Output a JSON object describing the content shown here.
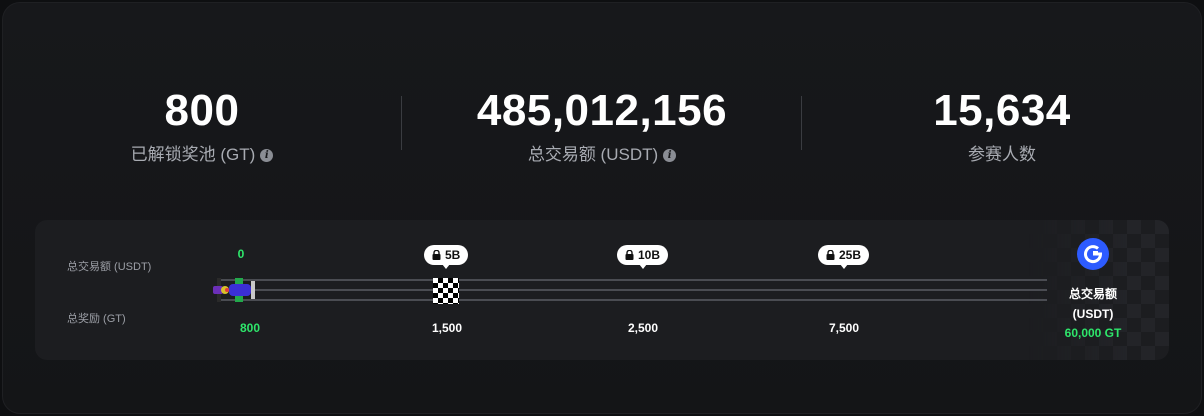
{
  "stats": [
    {
      "value": "800",
      "label": "已解锁奖池 (GT)",
      "info": true
    },
    {
      "value": "485,012,156",
      "label": "总交易额 (USDT)",
      "info": true
    },
    {
      "value": "15,634",
      "label": "参赛人数",
      "info": false
    }
  ],
  "progress": {
    "row_labels": {
      "volume": "总交易额 (USDT)",
      "reward": "总奖励 (GT)"
    },
    "current": {
      "volume": "0",
      "reward": "800"
    },
    "milestones": [
      {
        "volume": "5B",
        "reward": "1,500",
        "locked": true
      },
      {
        "volume": "10B",
        "reward": "2,500",
        "locked": true
      },
      {
        "volume": "25B",
        "reward": "7,500",
        "locked": true
      }
    ],
    "final": {
      "label_line1": "总交易额",
      "label_line2": "(USDT)",
      "reward": "60,000 GT"
    }
  },
  "icons": {
    "info": "info-icon",
    "lock": "lock-icon",
    "flag": "checkered-flag-icon",
    "car": "race-car-icon",
    "coin": "gate-token-icon"
  },
  "colors": {
    "accent_green": "#2ee66b",
    "coin_blue": "#2d5bff"
  }
}
